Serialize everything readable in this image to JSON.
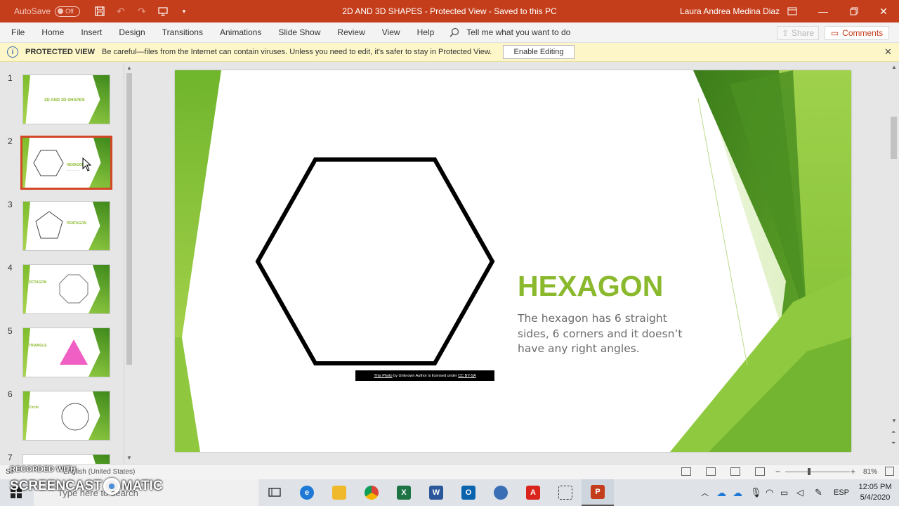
{
  "titlebar": {
    "autosave_label": "AutoSave",
    "autosave_state": "Off",
    "title": "2D AND 3D SHAPES  -  Protected View  -  Saved to this PC",
    "user": "Laura Andrea Medina Diaz"
  },
  "menu": {
    "items": [
      "File",
      "Home",
      "Insert",
      "Design",
      "Transitions",
      "Animations",
      "Slide Show",
      "Review",
      "View",
      "Help"
    ],
    "tellme": "Tell me what you want to do",
    "share": "Share",
    "comments": "Comments"
  },
  "protected": {
    "title": "PROTECTED VIEW",
    "message": "Be careful—files from the Internet can contain viruses. Unless you need to edit, it's safer to stay in Protected View.",
    "enable_button": "Enable Editing"
  },
  "thumbnails": [
    {
      "num": "1",
      "title": "2D AND 3D SHAPES"
    },
    {
      "num": "2",
      "title": "HEXAGON"
    },
    {
      "num": "3",
      "title": "PENTAGON"
    },
    {
      "num": "4",
      "title": "OCTAGON"
    },
    {
      "num": "5",
      "title": "TRIANGLE"
    },
    {
      "num": "6",
      "title": "Circle"
    },
    {
      "num": "7",
      "title": ""
    }
  ],
  "slide": {
    "title": "HEXAGON",
    "body": "The hexagon has 6 straight sides, 6 corners and it doesn’t have any right angles.",
    "caption_link1": "This Photo",
    "caption_mid": " by Unknown Author is licensed under ",
    "caption_link2": "CC BY-SA"
  },
  "status": {
    "slide_label": "Sli",
    "language": "English (United States)",
    "zoom": "81%"
  },
  "taskbar": {
    "search_placeholder": "Type here to search",
    "lang": "ESP",
    "time": "12:05 PM",
    "date": "5/4/2020"
  },
  "watermark": {
    "small": "RECORDED WITH",
    "big_left": "SCREENCAST",
    "big_right": "MATIC"
  },
  "colors": {
    "accent": "#c43e1c",
    "title_green": "#8ab92d",
    "selection": "#d24726"
  }
}
